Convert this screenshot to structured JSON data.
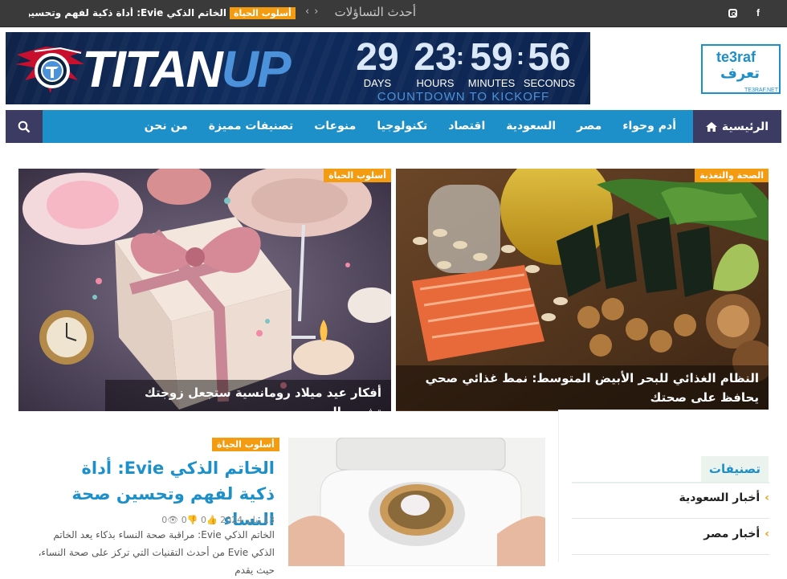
{
  "topbar": {
    "latest_label": "أحدث التساؤلات",
    "ticker_category": "أسلوب الحياة",
    "ticker_text": "الخاتم الذكي Evie: أداة ذكية لفهم وتحسين صحة ...",
    "social": [
      "facebook-icon",
      "instagram-icon"
    ]
  },
  "banner": {
    "brand_part1": "TITAN",
    "brand_part2": "UP",
    "countdown": [
      {
        "num": "29",
        "label": "DAYS"
      },
      {
        "num": "23",
        "label": "HOURS"
      },
      {
        "num": "59",
        "label": "MINUTES"
      },
      {
        "num": "56",
        "label": "SECONDS"
      }
    ],
    "subtitle": "COUNTDOWN TO KICKOFF"
  },
  "site_logo": {
    "en": "te3raf",
    "ar": "تعرف",
    "small": "TE3RAF.NET"
  },
  "nav": {
    "home": "الرئيسية",
    "items": [
      "أدم وحواء",
      "مصر",
      "السعودية",
      "اقتصاد",
      "تكنولوجيا",
      "منوعات",
      "تصنيفات مميزة",
      "من نحن"
    ]
  },
  "featured": [
    {
      "category": "الصحة والتغذية",
      "title": "النظام الغذائي للبحر الأبيض المتوسط: نمط غذائي صحي يحافظ على صحتك"
    },
    {
      "category": "أسلوب الحياة",
      "title": "أفكار عيد ميلاد رومانسية ستجعل زوجتك تشعر بالحب"
    }
  ],
  "article": {
    "category": "أسلوب الحياة",
    "title": "الخاتم الذكي Evie: أداة ذكية لفهم وتحسين صحة النساء",
    "date": "13 يناير 2024",
    "likes": "0",
    "dislikes": "0",
    "views": "0",
    "excerpt": "الخاتم الذكي Evie: مراقبة صحة النساء بذكاء يعد الخاتم الذكي Evie من أحدث التقنيات التي تركز على صحة النساء، حيث يقدم"
  },
  "sidebar": {
    "heading": "تصنيفات",
    "items": [
      "أخبار السعودية",
      "أخبار مصر"
    ]
  },
  "colors": {
    "accent": "#1d8fc9",
    "badge": "#f39c12",
    "dark": "#3a3a3a",
    "nav_dark": "#3b3b63"
  }
}
